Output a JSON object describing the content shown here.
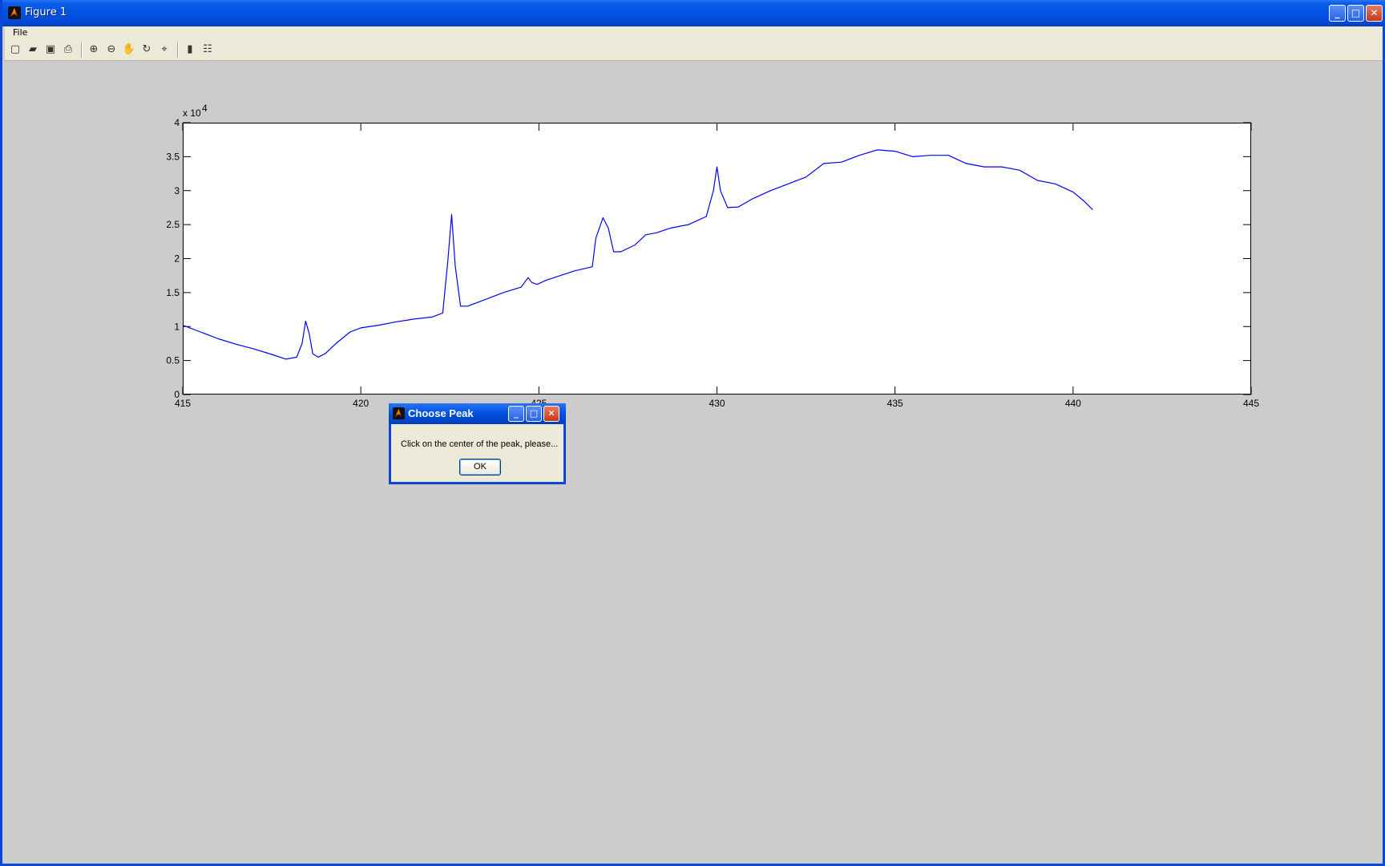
{
  "window": {
    "title": "Figure 1",
    "icon": "matlab-icon"
  },
  "menu": {
    "items": [
      "File"
    ]
  },
  "toolbar": {
    "icons": [
      "new-figure-icon",
      "open-file-icon",
      "save-icon",
      "print-icon",
      "zoom-in-icon",
      "zoom-out-icon",
      "pan-hand-icon",
      "rotate-3d-icon",
      "data-cursor-icon",
      "colorbar-icon",
      "legend-icon"
    ]
  },
  "chart_data": {
    "type": "line",
    "title": "",
    "xlabel": "",
    "ylabel": "",
    "y_exponent_label": "x 10",
    "y_exponent_power": "4",
    "xlim": [
      415,
      445
    ],
    "ylim": [
      0,
      4
    ],
    "x_ticks": [
      "415",
      "420",
      "425",
      "430",
      "435",
      "440",
      "445"
    ],
    "y_ticks": [
      "0",
      "0.5",
      "1",
      "1.5",
      "2",
      "2.5",
      "3",
      "3.5",
      "4"
    ],
    "grid": false,
    "line_color": "#0000ff",
    "series": [
      {
        "x": [
          415.0,
          415.5,
          416.0,
          416.5,
          417.0,
          417.5,
          417.9,
          418.2,
          418.35,
          418.45,
          418.55,
          418.65,
          418.8,
          419.0,
          419.3,
          419.7,
          420.0,
          420.5,
          421.0,
          421.5,
          422.0,
          422.3,
          422.45,
          422.55,
          422.65,
          422.8,
          423.0,
          423.5,
          424.0,
          424.5,
          424.7,
          424.8,
          424.95,
          425.2,
          425.6,
          426.0,
          426.5,
          426.6,
          426.8,
          426.95,
          427.1,
          427.3,
          427.7,
          428.0,
          428.3,
          428.7,
          429.2,
          429.7,
          429.9,
          430.0,
          430.1,
          430.3,
          430.6,
          431.0,
          431.5,
          432.0,
          432.5,
          433.0,
          433.5,
          434.0,
          434.5,
          435.0,
          435.5,
          436.0,
          436.5,
          437.0,
          437.5,
          438.0,
          438.5,
          439.0,
          439.5,
          440.0,
          440.3,
          440.55
        ],
        "y": [
          1.02,
          0.92,
          0.82,
          0.74,
          0.67,
          0.59,
          0.52,
          0.55,
          0.75,
          1.08,
          0.9,
          0.6,
          0.55,
          0.6,
          0.75,
          0.92,
          0.98,
          1.02,
          1.07,
          1.11,
          1.14,
          1.2,
          2.0,
          2.65,
          1.9,
          1.3,
          1.3,
          1.4,
          1.5,
          1.58,
          1.72,
          1.65,
          1.62,
          1.68,
          1.75,
          1.82,
          1.88,
          2.3,
          2.6,
          2.45,
          2.1,
          2.1,
          2.2,
          2.35,
          2.38,
          2.45,
          2.5,
          2.62,
          3.0,
          3.35,
          3.0,
          2.75,
          2.76,
          2.88,
          3.0,
          3.1,
          3.2,
          3.4,
          3.42,
          3.52,
          3.6,
          3.58,
          3.5,
          3.52,
          3.52,
          3.4,
          3.35,
          3.35,
          3.3,
          3.15,
          3.1,
          2.98,
          2.85,
          2.72
        ]
      }
    ]
  },
  "dialog": {
    "title": "Choose Peak",
    "icon": "matlab-icon",
    "message": "Click on the center of the peak, please...",
    "ok_label": "OK"
  }
}
